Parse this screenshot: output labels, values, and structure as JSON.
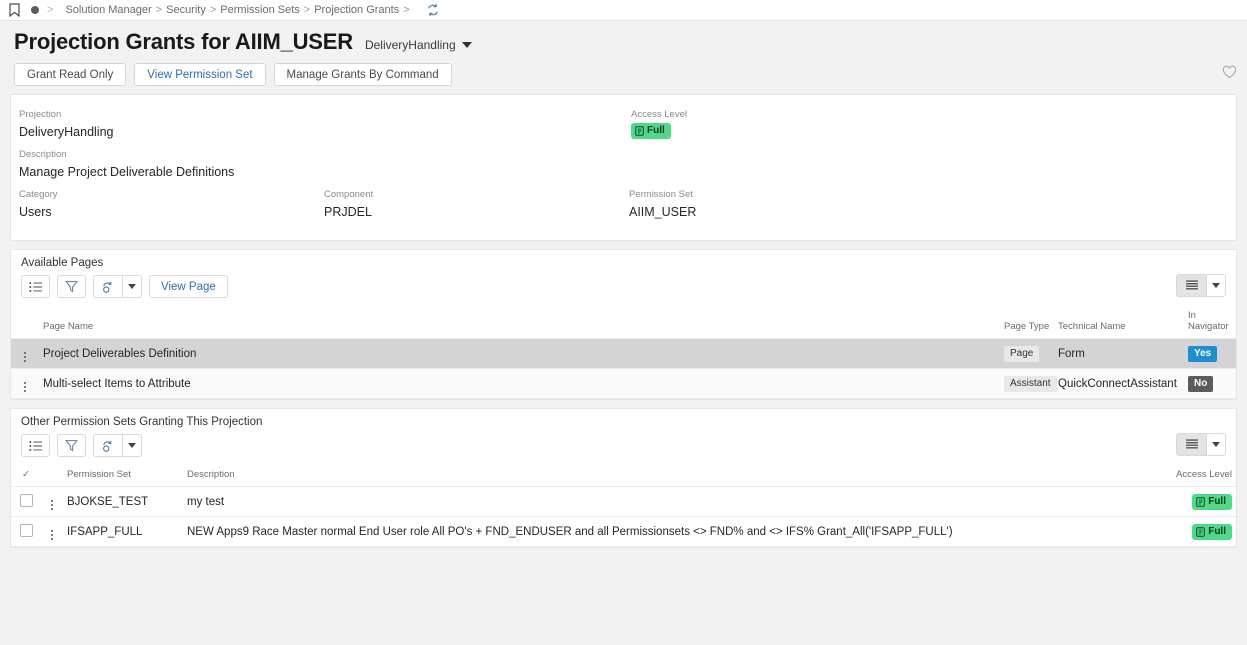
{
  "breadcrumb": {
    "bookmark_icon": "bookmark-icon",
    "items": [
      "Solution Manager",
      "Security",
      "Permission Sets",
      "Projection Grants"
    ],
    "refresh_icon": "refresh-icon"
  },
  "header": {
    "title": "Projection Grants for AIIM_USER",
    "selector_label": "DeliveryHandling"
  },
  "tabs": [
    {
      "label": "Grant Read Only",
      "active": false
    },
    {
      "label": "View Permission Set",
      "active": true
    },
    {
      "label": "Manage Grants By Command",
      "active": false
    }
  ],
  "favorite_icon": "heart-icon",
  "info": {
    "projection_label": "Projection",
    "projection_value": "DeliveryHandling",
    "access_level_label": "Access Level",
    "access_level_value": "Full",
    "description_label": "Description",
    "description_value": "Manage Project Deliverable Definitions",
    "category_label": "Category",
    "category_value": "Users",
    "component_label": "Component",
    "component_value": "PRJDEL",
    "permission_set_label": "Permission Set",
    "permission_set_value": "AIIM_USER"
  },
  "available_pages": {
    "section_title": "Available Pages",
    "toolbar": {
      "list_icon": "list-view-icon",
      "filter_icon": "filter-icon",
      "refresh_icon": "refresh-cycle-icon",
      "dropdown_icon": "chevron-down-icon",
      "view_page_label": "View Page",
      "rows_icon": "rows-view-icon",
      "settings_caret_icon": "chevron-down-icon"
    },
    "columns": [
      "Page Name",
      "Page Type",
      "Technical Name",
      "In Navigator"
    ],
    "rows": [
      {
        "page_name": "Project Deliverables Definition",
        "page_type": "Page",
        "technical_name": "Form",
        "in_navigator": "Yes",
        "selected": true
      },
      {
        "page_name": "Multi-select Items to Attribute",
        "page_type": "Assistant",
        "technical_name": "QuickConnectAssistant",
        "in_navigator": "No",
        "selected": false
      }
    ]
  },
  "other_permission_sets": {
    "section_title": "Other Permission Sets Granting This Projection",
    "toolbar": {
      "list_icon": "list-view-icon",
      "filter_icon": "filter-icon",
      "refresh_icon": "refresh-cycle-icon",
      "dropdown_icon": "chevron-down-icon",
      "rows_icon": "rows-view-icon",
      "settings_caret_icon": "chevron-down-icon"
    },
    "columns": [
      "Permission Set",
      "Description",
      "Access Level"
    ],
    "rows": [
      {
        "permission_set": "BJOKSE_TEST",
        "description": "my test",
        "access_level": "Full",
        "checked": false
      },
      {
        "permission_set": "IFSAPP_FULL",
        "description": "NEW Apps9 Race Master normal End User role All PO's + FND_ENDUSER and all Permissionsets <> FND% and <> IFS% Grant_All('IFSAPP_FULL')",
        "access_level": "Full",
        "checked": false
      }
    ]
  },
  "colors": {
    "accent_blue": "#2a6fb5",
    "badge_green": "#4ddb8a",
    "badge_blue": "#1b8fd1",
    "badge_dark": "#5b5b5b",
    "page_bg": "#f2f2f2"
  }
}
